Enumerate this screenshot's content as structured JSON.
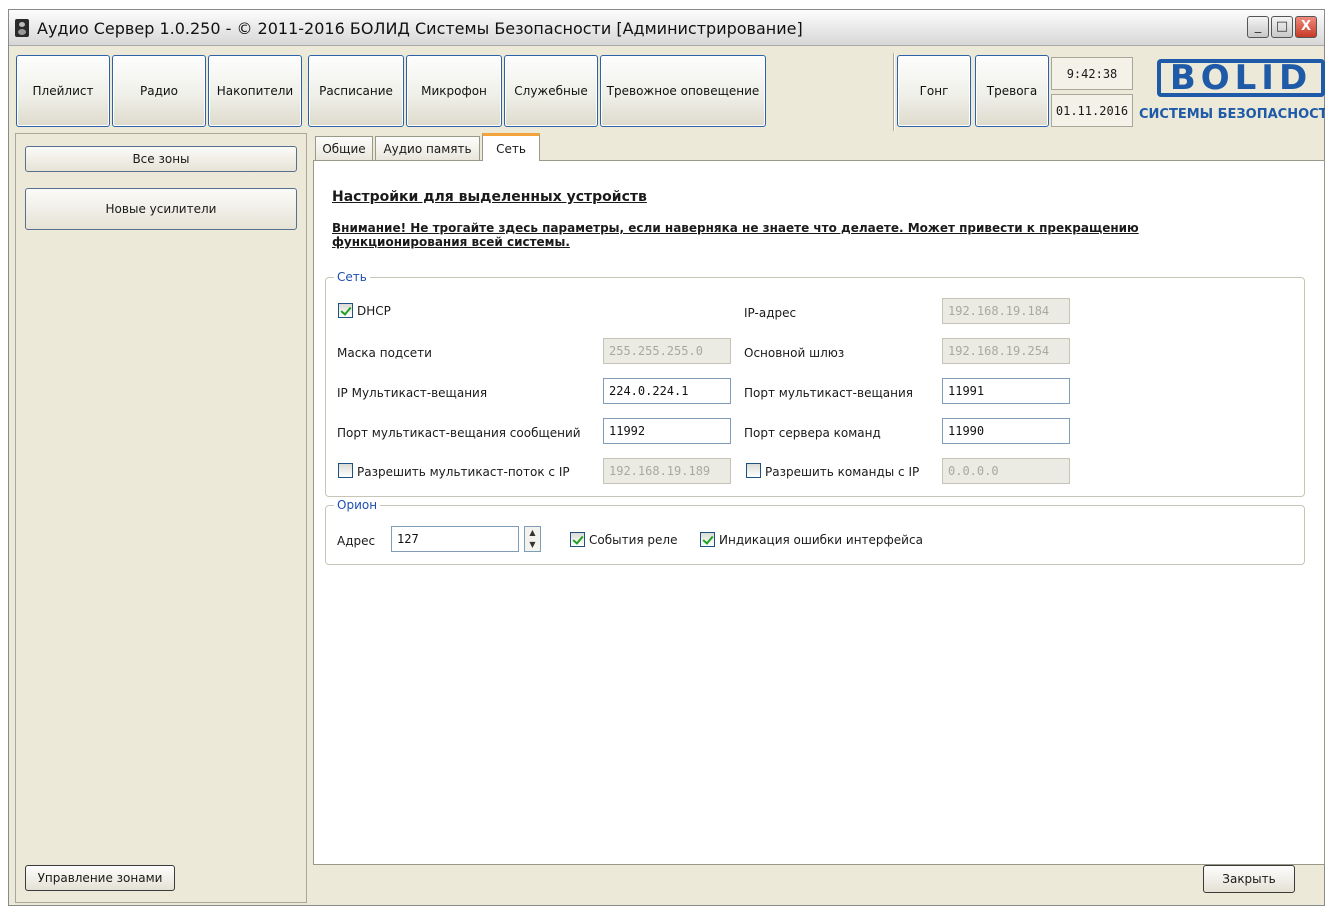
{
  "window": {
    "title": "Аудио Сервер 1.0.250 - © 2011-2016 БОЛИД Системы Безопасности [Администрирование]",
    "minimize_glyph": "_",
    "maximize_glyph": "□",
    "close_glyph": "X"
  },
  "toolbar": {
    "buttons": [
      {
        "label": "Плейлист"
      },
      {
        "label": "Радио"
      },
      {
        "label": "Накопители"
      },
      {
        "label": "Расписание"
      },
      {
        "label": "Микрофон"
      },
      {
        "label": "Служебные"
      },
      {
        "label": "Тревожное оповещение"
      }
    ],
    "gong_label": "Гонг",
    "alarm_label": "Тревога",
    "time": "9:42:38",
    "date": "01.11.2016",
    "logo_text": "BOLID",
    "logo_subtitle": "СИСТЕМЫ БЕЗОПАСНОСТИ"
  },
  "sidebar": {
    "all_zones_label": "Все зоны",
    "new_amplifiers_label": "Новые усилители",
    "manage_zones_label": "Управление зонами"
  },
  "tabs": [
    {
      "label": "Общие"
    },
    {
      "label": "Аудио память"
    },
    {
      "label": "Сеть",
      "active": true
    }
  ],
  "main": {
    "heading": "Настройки для выделенных устройств",
    "warning": "Внимание! Не трогайте здесь параметры, если наверняка не знаете что делаете. Может привести к прекращению функционирования всей системы.",
    "network_group": {
      "legend": "Сеть",
      "dhcp_label": "DHCP",
      "dhcp_checked": true,
      "ip_address_label": "IP-адрес",
      "ip_address_value": "192.168.19.184",
      "subnet_mask_label": "Маска подсети",
      "subnet_mask_value": "255.255.255.0",
      "gateway_label": "Основной шлюз",
      "gateway_value": "192.168.19.254",
      "multicast_ip_label": "IP Мультикаст-вещания",
      "multicast_ip_value": "224.0.224.1",
      "multicast_port_label": "Порт мультикаст-вещания",
      "multicast_port_value": "11991",
      "msg_multicast_port_label": "Порт мультикаст-вещания сообщений",
      "msg_multicast_port_value": "11992",
      "command_server_port_label": "Порт сервера команд",
      "command_server_port_value": "11990",
      "allow_multicast_label": "Разрешить мультикаст-поток с IP",
      "allow_multicast_checked": false,
      "allow_multicast_value": "192.168.19.189",
      "allow_commands_label": "Разрешить команды с IP",
      "allow_commands_checked": false,
      "allow_commands_value": "0.0.0.0"
    },
    "orion_group": {
      "legend": "Орион",
      "address_label": "Адрес",
      "address_value": "127",
      "relay_events_label": "События реле",
      "relay_events_checked": true,
      "interface_error_label": "Индикация ошибки интерфейса",
      "interface_error_checked": true
    }
  },
  "footer": {
    "close_label": "Закрыть"
  },
  "colors": {
    "accent_blue": "#1e5aa8",
    "legend_blue": "#1d4fb0",
    "active_tab_orange": "#f2a43a",
    "check_green": "#21a121"
  }
}
